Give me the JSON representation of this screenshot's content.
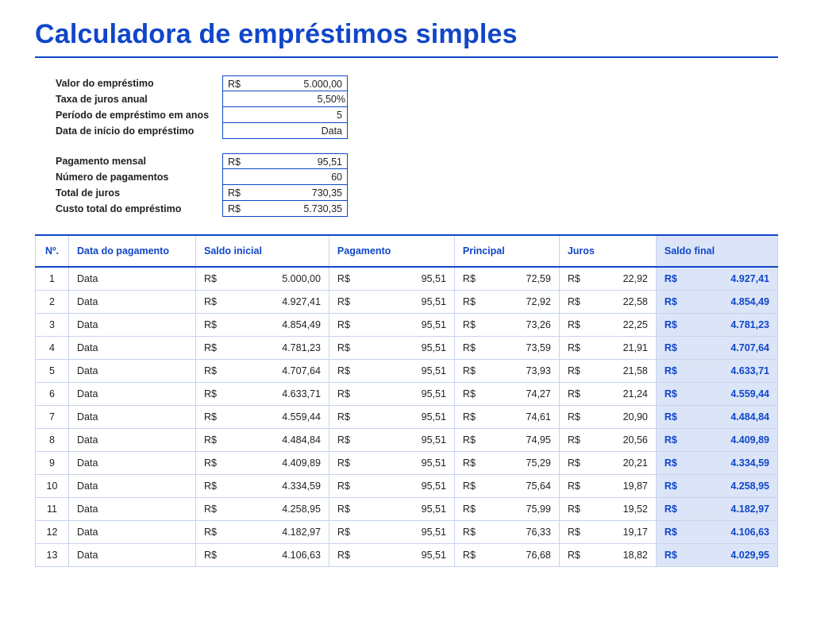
{
  "title": "Calculadora de empréstimos simples",
  "currency": "R$",
  "inputs": [
    {
      "label": "Valor do empréstimo",
      "currency": true,
      "value": "5.000,00"
    },
    {
      "label": "Taxa de juros anual",
      "currency": false,
      "value": "5,50%"
    },
    {
      "label": "Período de empréstimo em anos",
      "currency": false,
      "value": "5"
    },
    {
      "label": "Data de início do empréstimo",
      "currency": false,
      "value": "Data"
    }
  ],
  "outputs": [
    {
      "label": "Pagamento mensal",
      "currency": true,
      "value": "95,51"
    },
    {
      "label": "Número de pagamentos",
      "currency": false,
      "value": "60"
    },
    {
      "label": "Total de juros",
      "currency": true,
      "value": "730,35"
    },
    {
      "label": "Custo total do empréstimo",
      "currency": true,
      "value": "5.730,35"
    }
  ],
  "table": {
    "headers": [
      "Nº.",
      "Data do pagamento",
      "Saldo inicial",
      "Pagamento",
      "Principal",
      "Juros",
      "Saldo final"
    ],
    "rows": [
      {
        "n": "1",
        "date": "Data",
        "inicial": "5.000,00",
        "pagamento": "95,51",
        "principal": "72,59",
        "juros": "22,92",
        "final": "4.927,41"
      },
      {
        "n": "2",
        "date": "Data",
        "inicial": "4.927,41",
        "pagamento": "95,51",
        "principal": "72,92",
        "juros": "22,58",
        "final": "4.854,49"
      },
      {
        "n": "3",
        "date": "Data",
        "inicial": "4.854,49",
        "pagamento": "95,51",
        "principal": "73,26",
        "juros": "22,25",
        "final": "4.781,23"
      },
      {
        "n": "4",
        "date": "Data",
        "inicial": "4.781,23",
        "pagamento": "95,51",
        "principal": "73,59",
        "juros": "21,91",
        "final": "4.707,64"
      },
      {
        "n": "5",
        "date": "Data",
        "inicial": "4.707,64",
        "pagamento": "95,51",
        "principal": "73,93",
        "juros": "21,58",
        "final": "4.633,71"
      },
      {
        "n": "6",
        "date": "Data",
        "inicial": "4.633,71",
        "pagamento": "95,51",
        "principal": "74,27",
        "juros": "21,24",
        "final": "4.559,44"
      },
      {
        "n": "7",
        "date": "Data",
        "inicial": "4.559,44",
        "pagamento": "95,51",
        "principal": "74,61",
        "juros": "20,90",
        "final": "4.484,84"
      },
      {
        "n": "8",
        "date": "Data",
        "inicial": "4.484,84",
        "pagamento": "95,51",
        "principal": "74,95",
        "juros": "20,56",
        "final": "4.409,89"
      },
      {
        "n": "9",
        "date": "Data",
        "inicial": "4.409,89",
        "pagamento": "95,51",
        "principal": "75,29",
        "juros": "20,21",
        "final": "4.334,59"
      },
      {
        "n": "10",
        "date": "Data",
        "inicial": "4.334,59",
        "pagamento": "95,51",
        "principal": "75,64",
        "juros": "19,87",
        "final": "4.258,95"
      },
      {
        "n": "11",
        "date": "Data",
        "inicial": "4.258,95",
        "pagamento": "95,51",
        "principal": "75,99",
        "juros": "19,52",
        "final": "4.182,97"
      },
      {
        "n": "12",
        "date": "Data",
        "inicial": "4.182,97",
        "pagamento": "95,51",
        "principal": "76,33",
        "juros": "19,17",
        "final": "4.106,63"
      },
      {
        "n": "13",
        "date": "Data",
        "inicial": "4.106,63",
        "pagamento": "95,51",
        "principal": "76,68",
        "juros": "18,82",
        "final": "4.029,95"
      }
    ]
  }
}
